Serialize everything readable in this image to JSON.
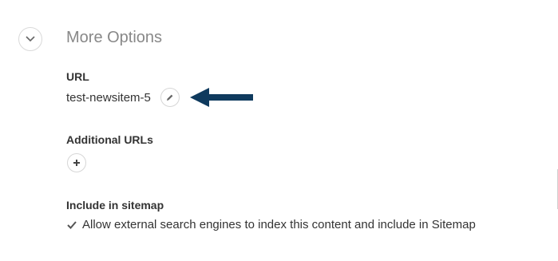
{
  "section": {
    "title": "More Options",
    "toggle_icon": "chevron-down-icon"
  },
  "url_field": {
    "label": "URL",
    "value": "test-newsitem-5",
    "edit_icon": "pencil-icon"
  },
  "additional_urls": {
    "label": "Additional URLs",
    "add_icon": "plus-icon"
  },
  "sitemap": {
    "label": "Include in sitemap",
    "checkbox_label": "Allow external search engines to index this content and include in Sitemap",
    "checked": true
  },
  "annotation": {
    "arrow_color": "#0f3a5e"
  }
}
